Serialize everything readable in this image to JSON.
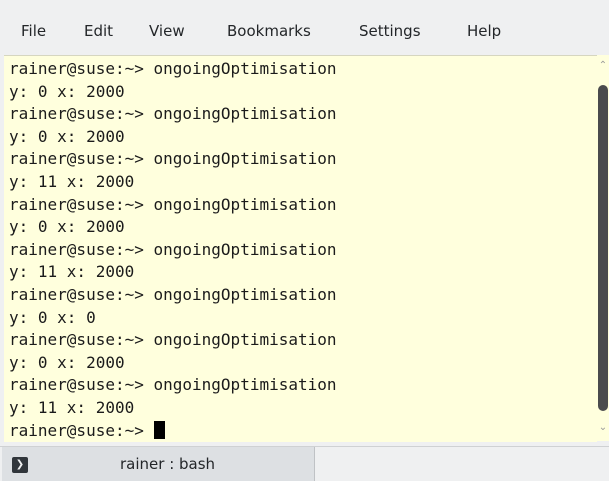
{
  "menubar": {
    "items": [
      {
        "label": "File"
      },
      {
        "label": "Edit"
      },
      {
        "label": "View"
      },
      {
        "label": "Bookmarks"
      },
      {
        "label": "Settings"
      },
      {
        "label": "Help"
      }
    ]
  },
  "terminal": {
    "lines": [
      "rainer@suse:~> ongoingOptimisation",
      "y: 0 x: 2000",
      "rainer@suse:~> ongoingOptimisation",
      "y: 0 x: 2000",
      "rainer@suse:~> ongoingOptimisation",
      "y: 11 x: 2000",
      "rainer@suse:~> ongoingOptimisation",
      "y: 0 x: 2000",
      "rainer@suse:~> ongoingOptimisation",
      "y: 11 x: 2000",
      "rainer@suse:~> ongoingOptimisation",
      "y: 0 x: 0",
      "rainer@suse:~> ongoingOptimisation",
      "y: 0 x: 2000",
      "rainer@suse:~> ongoingOptimisation",
      "y: 11 x: 2000"
    ],
    "prompt": "rainer@suse:~> ",
    "background": "#ffffdd",
    "scroll_position": 1.0
  },
  "tabs": [
    {
      "label": "rainer : bash",
      "icon": "terminal-icon"
    }
  ],
  "scrollbar": {
    "up_icon": "chevron-up-icon",
    "down_icon": "chevron-down-icon"
  }
}
